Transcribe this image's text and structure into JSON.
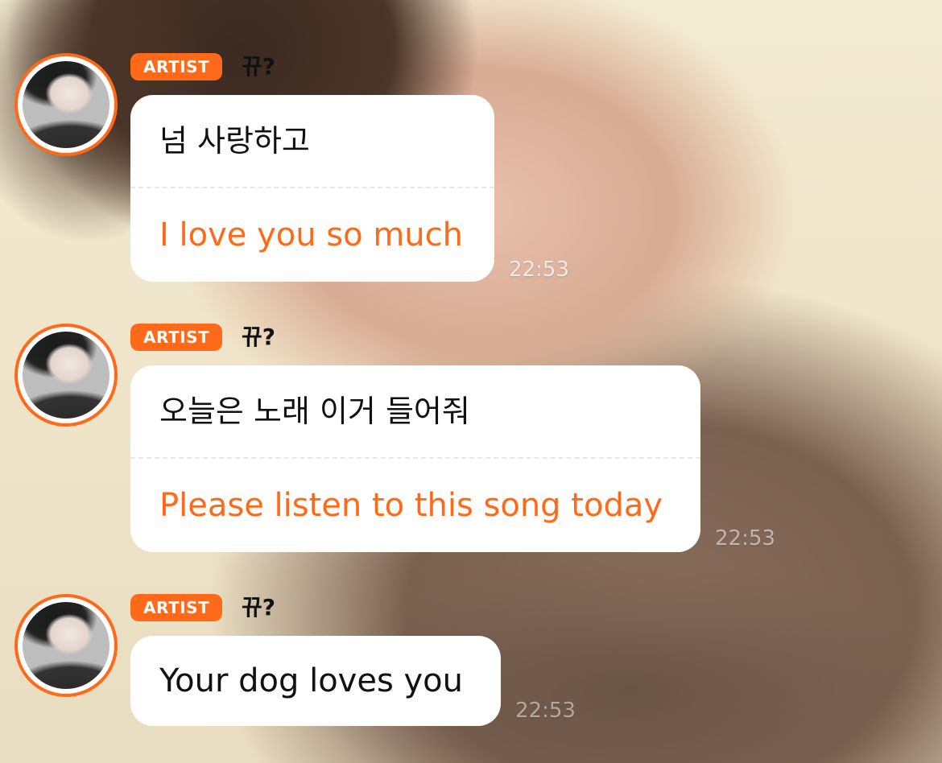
{
  "theme": {
    "accent": "#ff6a1a",
    "bubble_bg": "#ffffff",
    "text_primary": "#111111"
  },
  "messages": [
    {
      "badge": "ARTIST",
      "sender": "뀨?",
      "text": "넘 사랑하고",
      "translation": "I love you so much",
      "time": "22:53"
    },
    {
      "badge": "ARTIST",
      "sender": "뀨?",
      "text": "오늘은 노래 이거 들어줘",
      "translation": "Please listen to this song today",
      "time": "22:53"
    },
    {
      "badge": "ARTIST",
      "sender": "뀨?",
      "text": "Your dog loves you",
      "time": "22:53"
    }
  ]
}
